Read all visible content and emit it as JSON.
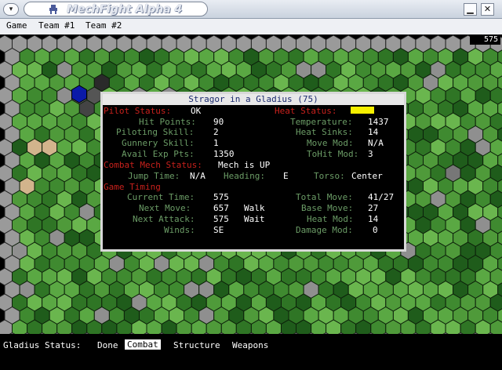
{
  "window": {
    "title": "MechFight Alpha 4",
    "minimize_glyph": "▁",
    "close_glyph": "✕",
    "menu_glyph": "▾"
  },
  "menu": [
    "Game",
    "Team #1",
    "Team #2"
  ],
  "board": {
    "counter": "575"
  },
  "popup": {
    "title": "Stragor in a Gladius (75)",
    "pilot_status_label": "Pilot Status:",
    "pilot_status_value": "OK",
    "heat_status_label": "Heat Status:",
    "heat_status_color": "#f7f000",
    "left_rows": [
      {
        "label": "Hit Points:",
        "value": "90"
      },
      {
        "label": "Piloting Skill:",
        "value": "2"
      },
      {
        "label": "Gunnery Skill:",
        "value": "1"
      },
      {
        "label": "Avail Exp Pts:",
        "value": "1350"
      }
    ],
    "right_rows": [
      {
        "label": "Temperature:",
        "value": "1437"
      },
      {
        "label": "Heat Sinks:",
        "value": "14"
      },
      {
        "label": "Move Mod:",
        "value": "N/A"
      },
      {
        "label": "ToHit Mod:",
        "value": "3"
      }
    ],
    "combat_label": "Combat Mech Status:",
    "combat_value": "Mech is UP",
    "jump_label": "Jump Time:",
    "jump_value": "N/A",
    "heading_label": "Heading:",
    "heading_value": "E",
    "torso_label": "Torso:",
    "torso_value": "Center",
    "game_timing_label": "Game Timing",
    "timing_left": [
      {
        "label": "Current Time:",
        "value": "575",
        "extra": ""
      },
      {
        "label": "Next Move:",
        "value": "657",
        "extra": "Walk"
      },
      {
        "label": "Next Attack:",
        "value": "575",
        "extra": "Wait"
      },
      {
        "label": "Winds:",
        "value": "SE",
        "extra": ""
      }
    ],
    "timing_right": [
      {
        "label": "Total Move:",
        "value": "41/27"
      },
      {
        "label": "Base Move:",
        "value": "27"
      },
      {
        "label": "Heat Mod:",
        "value": "14"
      },
      {
        "label": "Damage Mod:",
        "value": "0"
      }
    ]
  },
  "status": {
    "label": "Gladius Status:",
    "tabs": [
      "Done",
      "Combat",
      "Structure",
      "Weapons"
    ],
    "active_tab": "Combat"
  }
}
